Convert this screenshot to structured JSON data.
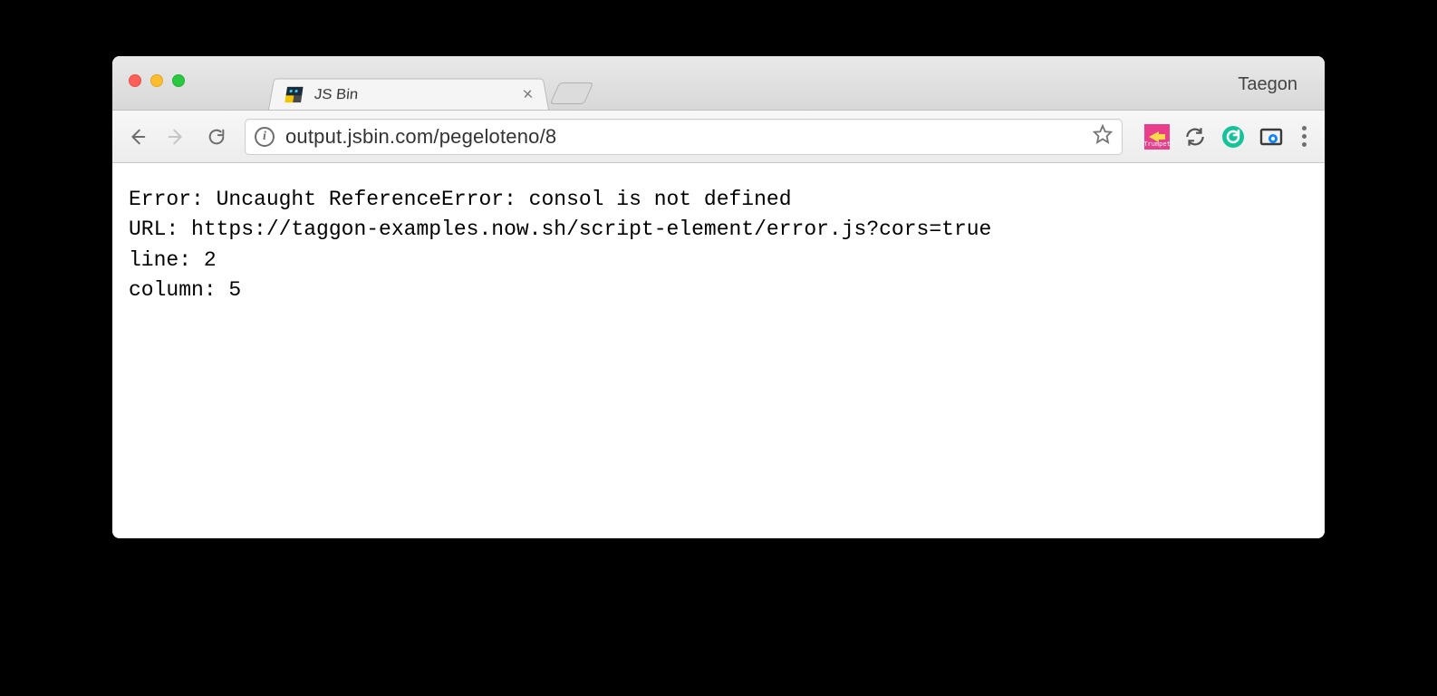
{
  "window": {
    "profile_name": "Taegon"
  },
  "tab": {
    "title": "JS Bin",
    "favicon": "jsbin"
  },
  "toolbar": {
    "url": "output.jsbin.com/pegeloteno/8"
  },
  "ext": {
    "trumpet_label": "Trumpet"
  },
  "page": {
    "lines": {
      "error": "Error: Uncaught ReferenceError: consol is not defined",
      "url": "URL: https://taggon-examples.now.sh/script-element/error.js?cors=true",
      "line": "line: 2",
      "column": "column: 5"
    }
  }
}
